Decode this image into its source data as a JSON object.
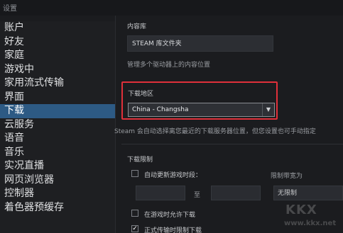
{
  "window": {
    "title": "设置"
  },
  "sidebar": {
    "items": [
      {
        "label": "账户",
        "active": false
      },
      {
        "label": "好友",
        "active": false
      },
      {
        "label": "家庭",
        "active": false
      },
      {
        "label": "游戏中",
        "active": false
      },
      {
        "label": "家用流式传输",
        "active": false
      },
      {
        "label": "界面",
        "active": false
      },
      {
        "label": "下载",
        "active": true
      },
      {
        "label": "云服务",
        "active": false
      },
      {
        "label": "语音",
        "active": false
      },
      {
        "label": "音乐",
        "active": false
      },
      {
        "label": "实况直播",
        "active": false
      },
      {
        "label": "网页浏览器",
        "active": false
      },
      {
        "label": "控制器",
        "active": false
      },
      {
        "label": "着色器预缓存",
        "active": false
      }
    ]
  },
  "content_library": {
    "heading": "内容库",
    "button_label": "STEAM 库文件夹",
    "description": "管理多个驱动器上的内容位置"
  },
  "download_region": {
    "heading": "下载地区",
    "selected": "China - Changsha",
    "note": "Steam 会自动选择离您最近的下载服务器位置，但您设置也可手动指定"
  },
  "download_limits": {
    "heading": "下载限制",
    "auto_update_label": "自动更新游戏时段：",
    "to_label": "至",
    "limit_speed_label": "限制带宽为",
    "limit_speed_value": "无限制",
    "allow_in_game_label": "在游戏时允许下载",
    "throttle_label": "正式传输时限制下载"
  },
  "watermark": {
    "brand": "KKX",
    "domain": "www.kkx.net"
  },
  "colors": {
    "accent": "#2d5a84",
    "highlight": "#e0303a"
  }
}
